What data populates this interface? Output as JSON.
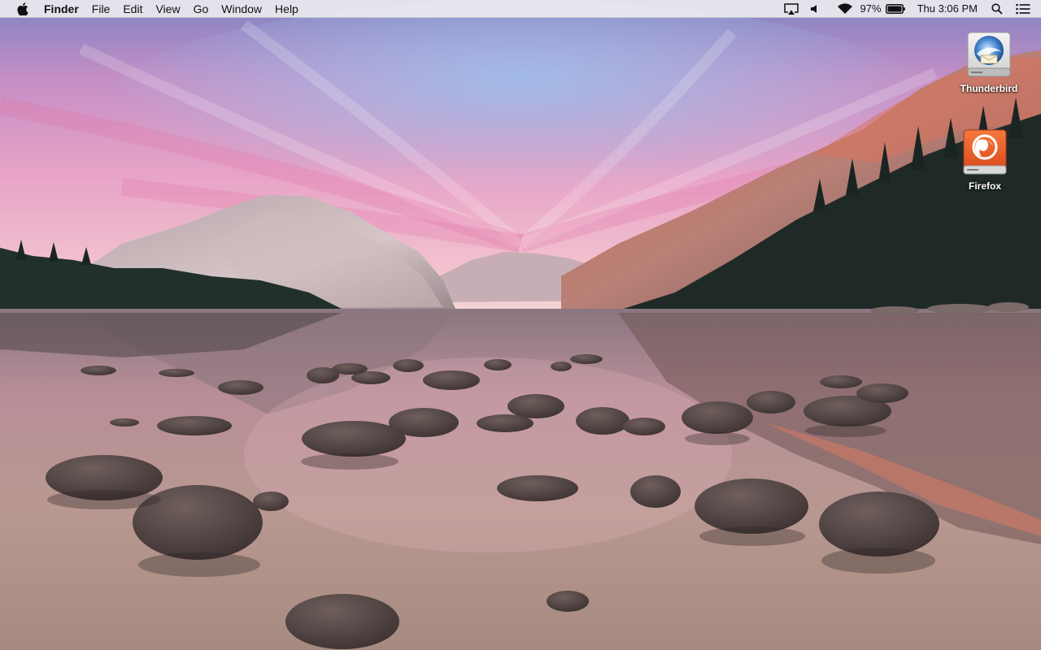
{
  "menubar": {
    "app_name": "Finder",
    "menus": [
      "File",
      "Edit",
      "View",
      "Go",
      "Window",
      "Help"
    ],
    "status": {
      "battery_percent": "97%",
      "clock": "Thu 3:06 PM",
      "icons": [
        "airplay-icon",
        "volume-icon",
        "wifi-icon",
        "battery-icon",
        "spotlight-search-icon",
        "notification-center-icon"
      ]
    }
  },
  "desktop": {
    "icons": [
      {
        "label": "Thunderbird",
        "icon": "thunderbird-drive-icon"
      },
      {
        "label": "Firefox",
        "icon": "firefox-drive-icon"
      }
    ],
    "wallpaper": "lake-mountain-sunset"
  },
  "colors": {
    "menubar_bg": "#ECECF0",
    "sky_pink": "#E98FB8",
    "sky_blue": "#8FB7E6",
    "water": "#9E7F84",
    "firefox_orange": "#F15A24"
  }
}
